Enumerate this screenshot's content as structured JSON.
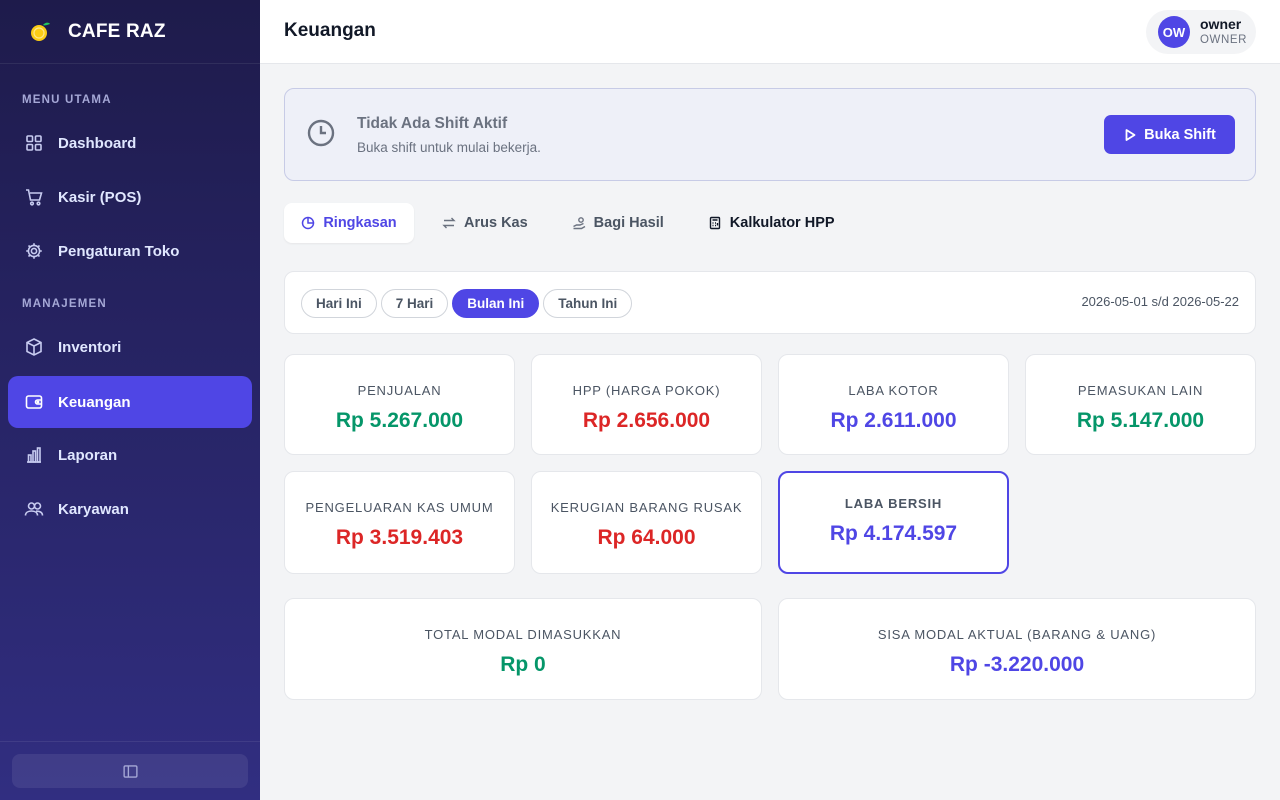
{
  "brand": {
    "name": "CAFE RAZ",
    "logo_icon": "lemon-icon"
  },
  "sidebar": {
    "section_main": "MENU UTAMA",
    "section_manage": "MANAJEMEN",
    "items": [
      {
        "label": "Dashboard",
        "icon": "grid-icon"
      },
      {
        "label": "Kasir (POS)",
        "icon": "cart-icon"
      },
      {
        "label": "Pengaturan Toko",
        "icon": "gear-icon"
      },
      {
        "label": "Inventori",
        "icon": "box-icon"
      },
      {
        "label": "Keuangan",
        "icon": "wallet-icon",
        "active": true
      },
      {
        "label": "Laporan",
        "icon": "bar-chart-icon"
      },
      {
        "label": "Karyawan",
        "icon": "users-icon"
      }
    ]
  },
  "header": {
    "title": "Keuangan",
    "user": {
      "initials": "OW",
      "name": "owner",
      "role": "OWNER"
    }
  },
  "shift": {
    "title": "Tidak Ada Shift Aktif",
    "subtitle": "Buka shift untuk mulai bekerja.",
    "button_label": "Buka Shift"
  },
  "tabs": [
    {
      "label": "Ringkasan",
      "icon": "pie-chart-icon",
      "active": true
    },
    {
      "label": "Arus Kas",
      "icon": "swap-arrows-icon"
    },
    {
      "label": "Bagi Hasil",
      "icon": "hand-coins-icon"
    },
    {
      "label": "Kalkulator HPP",
      "icon": "calculator-icon"
    }
  ],
  "filters": {
    "options": [
      "Hari Ini",
      "7 Hari",
      "Bulan Ini",
      "Tahun Ini"
    ],
    "selected": "Bulan Ini",
    "date_range": "2026-05-01 s/d 2026-05-22"
  },
  "summary": {
    "penjualan": {
      "label": "PENJUALAN",
      "value": "Rp 5.267.000"
    },
    "hpp": {
      "label": "HPP (HARGA POKOK)",
      "value": "Rp 2.656.000"
    },
    "laba_kotor": {
      "label": "LABA KOTOR",
      "value": "Rp 2.611.000"
    },
    "pemasukan_lain": {
      "label": "PEMASUKAN LAIN",
      "value": "Rp 5.147.000"
    },
    "pengeluaran": {
      "label": "PENGELUARAN KAS UMUM",
      "value": "Rp 3.519.403"
    },
    "kerugian": {
      "label": "KERUGIAN BARANG RUSAK",
      "value": "Rp 64.000"
    },
    "laba_bersih": {
      "label": "LABA BERSIH",
      "value": "Rp 4.174.597"
    },
    "total_modal": {
      "label": "TOTAL MODAL DIMASUKKAN",
      "value": "Rp 0"
    },
    "sisa_modal": {
      "label": "SISA MODAL AKTUAL (BARANG & UANG)",
      "value": "Rp -3.220.000"
    }
  },
  "colors": {
    "accent": "#4f46e5",
    "positive": "#059669",
    "negative": "#dc2626",
    "sidebar_top": "#1e1b4b",
    "sidebar_bottom": "#312e81"
  }
}
